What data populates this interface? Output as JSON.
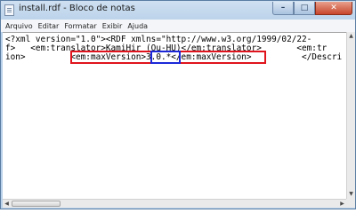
{
  "window": {
    "title": "install.rdf - Bloco de notas",
    "buttons": {
      "minimize": "–",
      "maximize": "□",
      "close": "✕"
    }
  },
  "menu": [
    "Arquivo",
    "Editar",
    "Formatar",
    "Exibir",
    "Ajuda"
  ],
  "editor": {
    "lines": [
      "<?xml version=\"1.0\"><RDF xmlns=\"http://www.w3.org/1999/02/22-",
      "f>   <em:translator>KamiHir (Ou-HU)</em:translator>       <em:tr",
      "ion>         <em:maxVersion>3.0.*</em:maxVersion>          </Descri"
    ],
    "highlight": {
      "outer": "<em:maxVersion>3.0.*</em:maxVersion>",
      "inner": "3.0.*",
      "outer_color": "#e0141c",
      "inner_color": "#1c28d8"
    }
  },
  "scrollbars": {
    "up": "▲",
    "down": "▼",
    "left": "◀",
    "right": "▶"
  }
}
